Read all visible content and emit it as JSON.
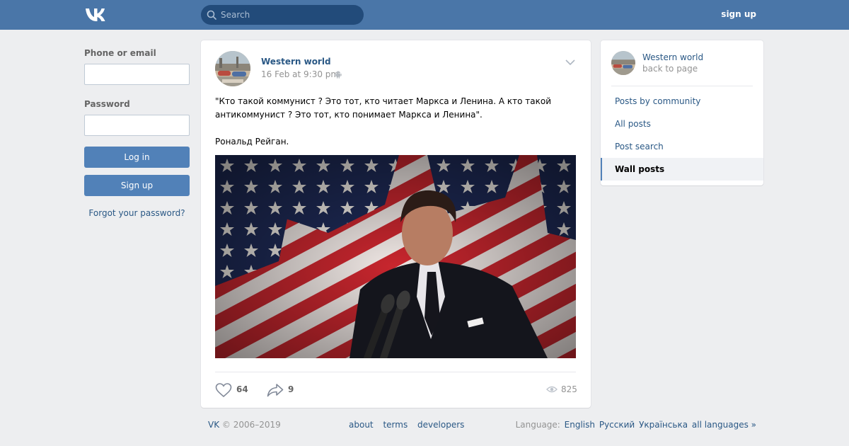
{
  "header": {
    "search_placeholder": "Search",
    "signup_label": "sign up",
    "bg_color": "#4a76a8",
    "logo_icon": "vk-logo-icon"
  },
  "login": {
    "phone_label": "Phone or email",
    "password_label": "Password",
    "login_button": "Log in",
    "signup_button": "Sign up",
    "forgot_link": "Forgot your password?"
  },
  "post": {
    "author": "Western world",
    "date": "16 Feb at 9:30 pm",
    "text_line1": "\"Кто такой коммунист ? Это тот, кто читает Маркса и Ленина. А кто такой",
    "text_line2": "антикоммунист ? Это тот, кто понимает Маркса и Ленина\".",
    "text_line3": "Рональд Рейган.",
    "likes": "64",
    "shares": "9",
    "views": "825"
  },
  "side": {
    "community_name": "Western world",
    "back_label": "back to page",
    "items": [
      {
        "label": "Posts by community",
        "active": false
      },
      {
        "label": "All posts",
        "active": false
      },
      {
        "label": "Post search",
        "active": false
      },
      {
        "label": "Wall posts",
        "active": true
      }
    ]
  },
  "footer": {
    "vk": "VK",
    "copyright": "© 2006–2019",
    "links": [
      "about",
      "terms",
      "developers"
    ],
    "language_label": "Language:",
    "languages": [
      "English",
      "Русский",
      "Українська",
      "all languages »"
    ]
  }
}
